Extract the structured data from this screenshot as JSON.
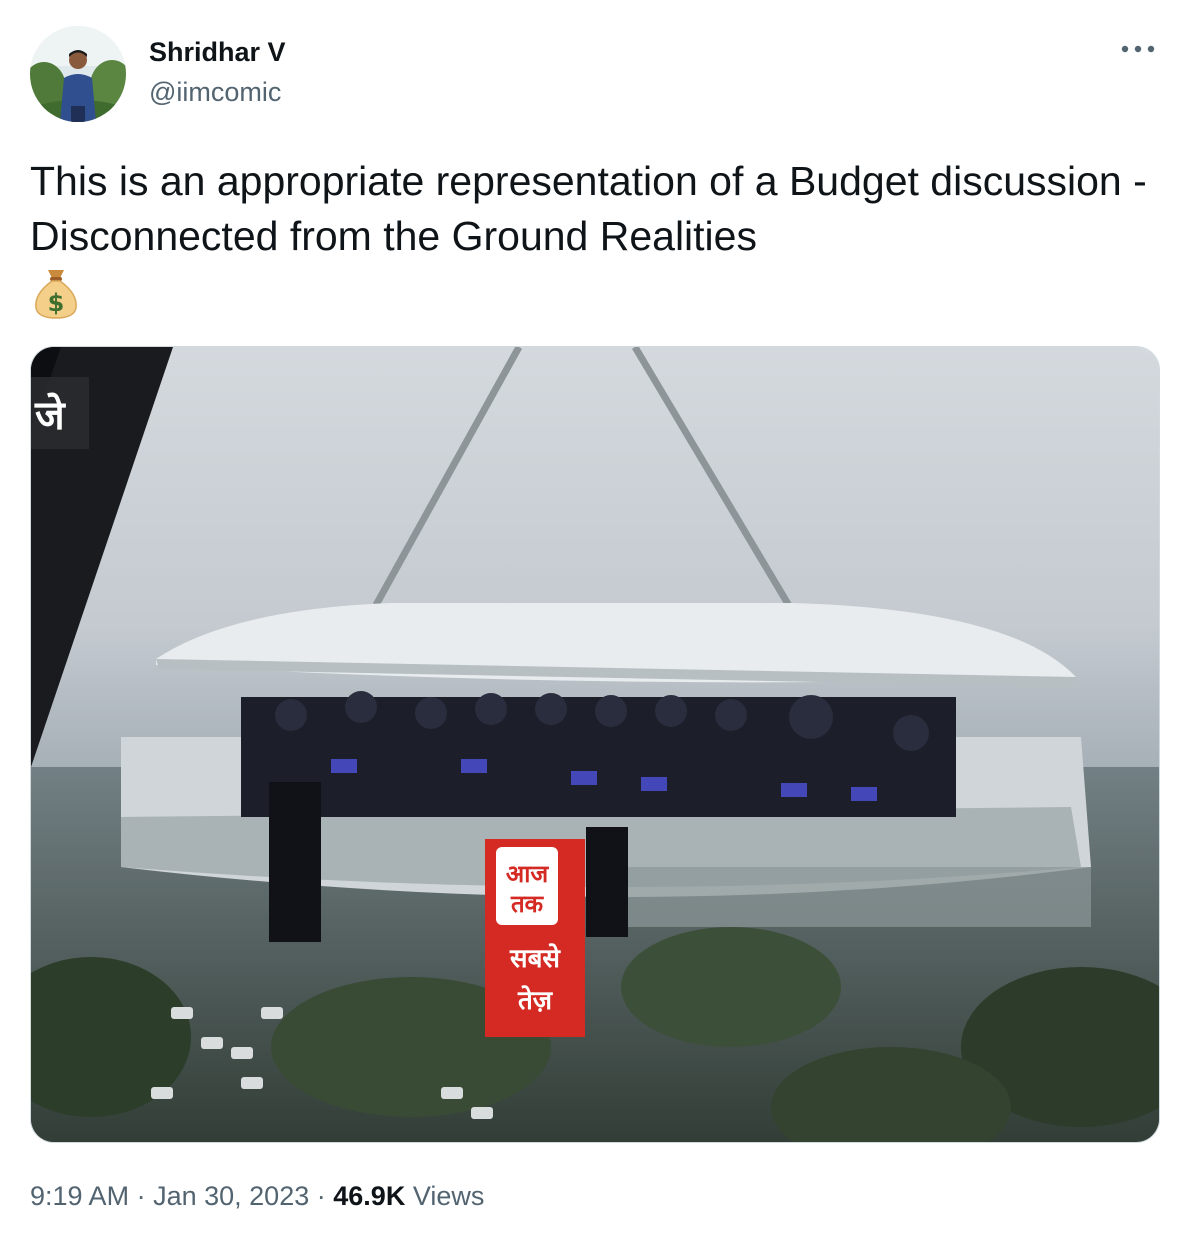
{
  "author": {
    "display_name": "Shridhar V",
    "handle": "@iimcomic"
  },
  "tweet": {
    "text": "This is an appropriate representation of a Budget discussion - Disconnected from the Ground Realities",
    "emoji": "money-bag"
  },
  "media": {
    "overlay_corner_text": "जे",
    "banner_logo_line1": "आज",
    "banner_logo_line2": "तक",
    "banner_line1": "सबसे",
    "banner_line2": "तेज़"
  },
  "meta": {
    "time": "9:19 AM",
    "separator": "·",
    "date": "Jan 30, 2023",
    "views_count": "46.9K",
    "views_label": "Views"
  },
  "colors": {
    "text_primary": "#0f1419",
    "text_secondary": "#536471",
    "border": "#cfd9de",
    "banner_red": "#d42a23"
  },
  "icons": {
    "more": "more-horizontal-icon",
    "emoji": "money-bag-icon"
  }
}
